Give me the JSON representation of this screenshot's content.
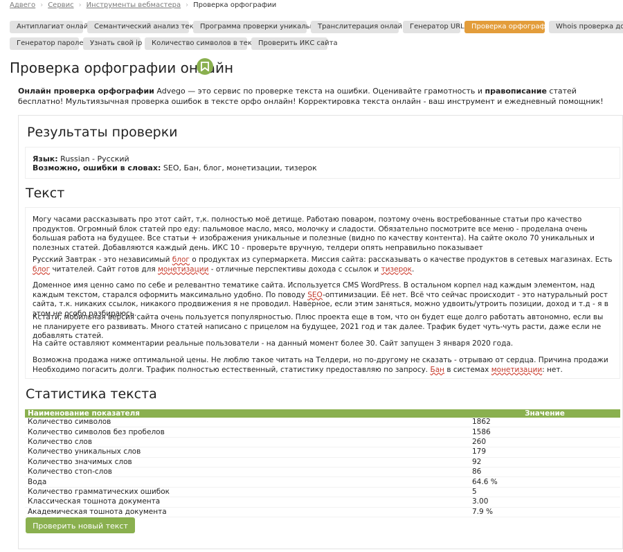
{
  "breadcrumb": [
    {
      "label": "Адвего"
    },
    {
      "label": "Сервис"
    },
    {
      "label": "Инструменты вебмастера"
    },
    {
      "label": "Проверка орфографии"
    }
  ],
  "tabs_row1": [
    "Антиплагиат онлайн",
    "Семантический анализ текста",
    "Программа проверки уникальности",
    "Транслитерация онлайн",
    "Генератор URL",
    "Проверка орфографии",
    "Whois проверка домена"
  ],
  "tabs_row2": [
    "Генератор паролей",
    "Узнать свой ip",
    "Количество символов в тексте",
    "Проверить ИКС сайта"
  ],
  "active_tab": "Проверка орфографии",
  "page_title": "Проверка орфографии онлайн",
  "intro": {
    "bold_lead": "Онлайн проверка орфографии",
    "part1": " Advego — это сервис по проверке текста на ошибки. Оценивайте грамотность и ",
    "bold_mid": "правописание",
    "part2": " статей бесплатно! Мультиязычная проверка ошибок в тексте орфо онлайн! Корректировка текста онлайн - ваш инструмент и ежедневный помощник!"
  },
  "results": {
    "title": "Результаты проверки",
    "lang_label": "Язык:",
    "lang_value": " Russian - Русский",
    "errors_label": "Возможно, ошибки в словах:",
    "errors_value": " SEO, Бан, блог, монетизации, тизерок"
  },
  "text_section": {
    "title": "Текст",
    "p1": "Могу часами рассказывать про этот сайт, т,к. полностью моё детище. Работаю поваром, поэтому очень востребованные статьи про качество продуктов. Огромный блок статей про еду: пальмовое масло, мясо, молочку и сладости. Обязательно посмотрите все меню - проделана очень большая работа на будущее. Все статьи + изображения уникальные и полезные (видно по качеству контента). На сайте около 70 уникальных и полезных статей. Добавляются каждый день. ИКС 10 - проверьте вручную, телдери опять неправильно показывает",
    "p2_a": "Русский Завтрак - это независимый ",
    "p2_e1": "блог",
    "p2_b": " о продуктах из супермаркета. Миссия сайта: рассказывать о качестве продуктов в сетевых магазинах. Есть ",
    "p2_e2": "блог",
    "p2_c": " читателей. Сайт готов для ",
    "p2_e3": "монетизации",
    "p2_d": " - отличные перспективы дохода с ссылок и ",
    "p2_e4": "тизерок",
    "p2_end": ".",
    "p3_a": "Доменное имя ценно само по себе и релевантно тематике сайта. Используется CMS WordPress. В остальном корпел над каждым элементом, над каждым текстом, старался оформить максимально удобно. По поводу ",
    "p3_e1": "SEO",
    "p3_b": "-оптимизации. Её нет. Всё что сейчас происходит - это натуральный рост сайта, т.к. никаких ссылок, никакого продвижения я не проводил. Наверное, если этим заняться, можно удвоить/утроить позиции, доход и т.д - я в этом не особо разбираюсь.",
    "p4": "Кстати, мобильная версия сайта очень пользуется популярностью. Плюс проекта еще в том, что он будет еще долго работать автономно, если вы не планируете его развивать. Много статей написано с прицелом на будущее, 2021 год и так далее. Трафик будет чуть-чуть расти, даже если не добавлять статей.",
    "p5": "На сайте оставляют комментарии реальные пользователи - на данный момент более 30. Сайт запущен 3 января 2020 года.",
    "p6_a": "Возможна продажа ниже оптимальной цены. Не люблю такое читать на Телдери, но по-другому не сказать - отрываю от сердца. Причина продажи Необходимо погасить долги. Трафик полностью естественный, статистику предоставляю по запросу. ",
    "p6_e1": "Бан",
    "p6_b": " в системах ",
    "p6_e2": "монетизации",
    "p6_c": ": нет."
  },
  "stats": {
    "title": "Статистика текста",
    "col_name": "Наименование показателя",
    "col_value": "Значение",
    "rows": [
      {
        "name": "Количество символов",
        "value": "1862"
      },
      {
        "name": "Количество символов без пробелов",
        "value": "1586"
      },
      {
        "name": "Количество слов",
        "value": "260"
      },
      {
        "name": "Количество уникальных слов",
        "value": "179"
      },
      {
        "name": "Количество значимых слов",
        "value": "92"
      },
      {
        "name": "Количество стоп-слов",
        "value": "86"
      },
      {
        "name": "Вода",
        "value": "64.6 %"
      },
      {
        "name": "Количество грамматических ошибок",
        "value": "5"
      },
      {
        "name": "Классическая тошнота документа",
        "value": "3.00"
      },
      {
        "name": "Академическая тошнота документа",
        "value": "7.9 %"
      }
    ]
  },
  "check_button": "Проверить новый текст",
  "colors": {
    "accent_green": "#8ab04f",
    "active_tab": "#e39d3b",
    "error_underline": "#d03a2a"
  }
}
